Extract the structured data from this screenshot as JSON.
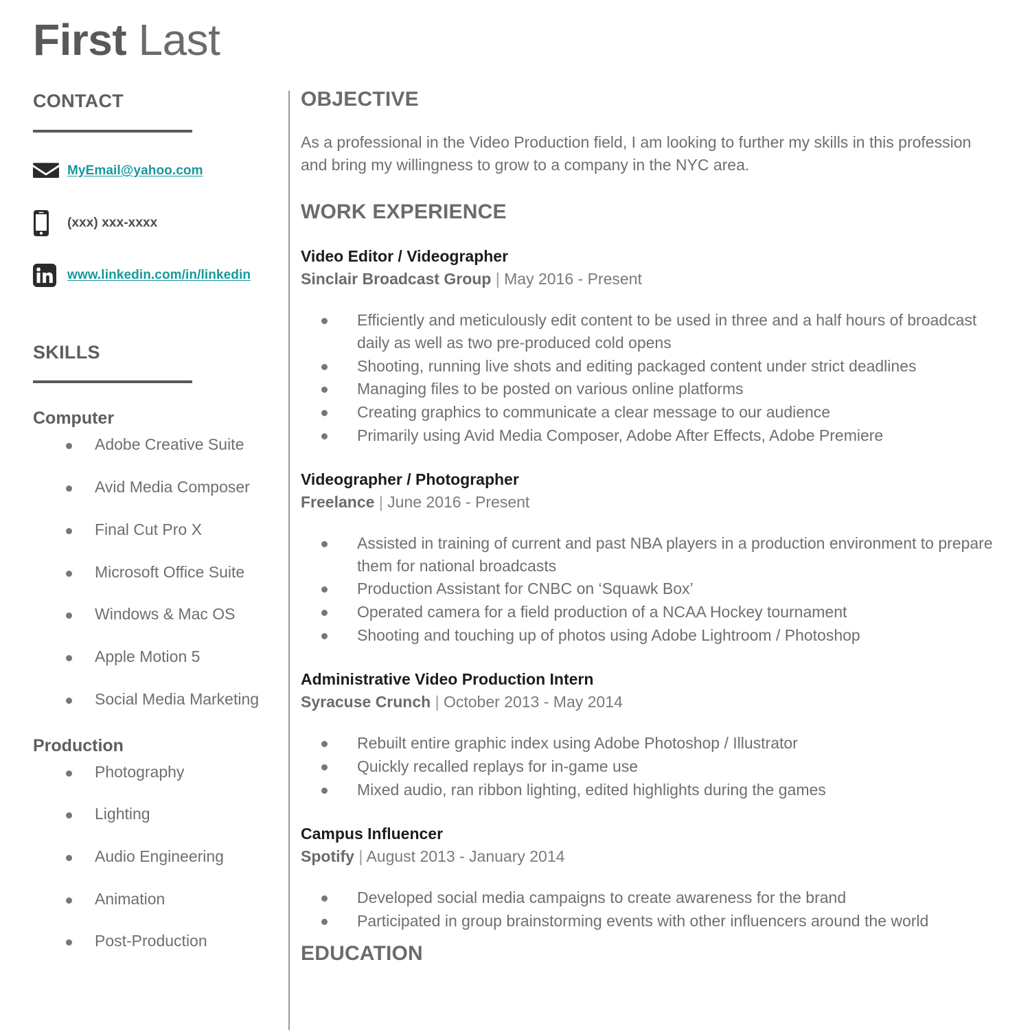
{
  "header": {
    "first_name": "First",
    "last_name": "Last"
  },
  "sidebar": {
    "contact": {
      "heading": "CONTACT",
      "items": [
        {
          "icon": "envelope-icon",
          "text": "MyEmail@yahoo.com",
          "is_link": true
        },
        {
          "icon": "smartphone-icon",
          "text": "(xxx) xxx-xxxx",
          "is_link": false
        },
        {
          "icon": "linkedin-icon",
          "text": "www.linkedin.com/in/linkedin",
          "is_link": true
        }
      ]
    },
    "skills": {
      "heading": "SKILLS",
      "groups": [
        {
          "title": "Computer",
          "items": [
            "Adobe Creative Suite",
            "Avid Media Composer",
            "Final Cut Pro X",
            "Microsoft Office Suite",
            "Windows & Mac OS",
            "Apple Motion 5",
            "Social Media Marketing"
          ]
        },
        {
          "title": "Production",
          "items": [
            "Photography",
            "Lighting",
            "Audio Engineering",
            "Animation",
            "Post-Production"
          ]
        }
      ]
    }
  },
  "main": {
    "objective": {
      "heading": "OBJECTIVE",
      "body": "As a professional in the Video Production field, I am looking to further my skills in this profession and bring my willingness to grow to a company in the NYC area."
    },
    "work_experience": {
      "heading": "WORK EXPERIENCE",
      "jobs": [
        {
          "title": "Video Editor / Videographer",
          "company": "Sinclair Broadcast Group",
          "separator": "|",
          "dates": "May 2016 - Present",
          "duties": [
            "Efficiently and meticulously edit content to be used in three and a half hours of broadcast daily as well as two pre-produced cold opens",
            "Shooting, running live shots and editing packaged content under strict deadlines",
            "Managing files to be posted on various online platforms",
            "Creating graphics to communicate a clear message to our audience",
            "Primarily using Avid Media Composer, Adobe After Effects, Adobe Premiere"
          ]
        },
        {
          "title": "Videographer / Photographer",
          "company": "Freelance",
          "separator": "|",
          "dates": "June 2016 - Present",
          "duties": [
            "Assisted in training of current and past NBA players in a production environment to prepare them for national broadcasts",
            "Production Assistant for CNBC on ‘Squawk Box’",
            "Operated camera for a field production of a NCAA Hockey tournament",
            "Shooting and touching up of photos using Adobe Lightroom / Photoshop"
          ]
        },
        {
          "title": "Administrative Video Production Intern",
          "company": "Syracuse Crunch",
          "separator": "|",
          "dates": "October 2013 - May 2014",
          "duties": [
            "Rebuilt entire graphic index using Adobe Photoshop / Illustrator",
            "Quickly recalled replays for in-game use",
            "Mixed audio, ran ribbon lighting, edited highlights during the games"
          ]
        },
        {
          "title": "Campus Influencer",
          "company": "Spotify",
          "separator": "|",
          "dates": "August 2013 - January 2014",
          "duties": [
            "Developed social media campaigns to create awareness for the brand",
            "Participated in group brainstorming events with other influencers around the world"
          ]
        }
      ]
    },
    "education": {
      "heading": "EDUCATION"
    }
  },
  "colors": {
    "link_teal": "#17999b",
    "heading_gray": "#6b6b6b",
    "body_gray": "#6e6e6e",
    "title_black": "#1c1c1c",
    "icon_dark": "#2b2b2b",
    "rule_gray": "#595959"
  }
}
